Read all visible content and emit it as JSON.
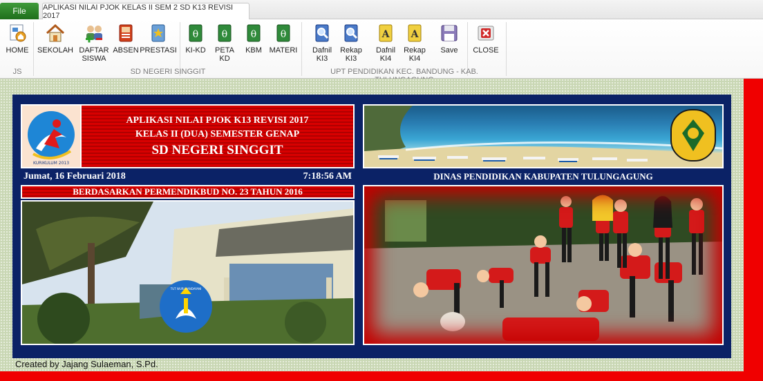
{
  "tabs": {
    "file": "File",
    "active": "APLIKASI NILAI PJOK KELAS II SEM 2 SD K13 REVISI 2017"
  },
  "ribbon": {
    "buttons": [
      {
        "label": "HOME",
        "icon": "home-page-icon"
      },
      {
        "label": "SEKOLAH",
        "icon": "house-icon"
      },
      {
        "label": "DAFTAR SISWA",
        "icon": "users-icon"
      },
      {
        "label": "ABSEN",
        "icon": "book-icon"
      },
      {
        "label": "PRESTASI",
        "icon": "trophy-book-icon"
      },
      {
        "label": "KI-KD",
        "icon": "theta-book-icon"
      },
      {
        "label": "PETA KD",
        "icon": "theta-book-icon"
      },
      {
        "label": "KBM",
        "icon": "theta-book-icon"
      },
      {
        "label": "MATERI",
        "icon": "theta-book-icon"
      },
      {
        "label": "Dafnil KI3",
        "icon": "magnifier-book-icon"
      },
      {
        "label": "Rekap KI3",
        "icon": "magnifier-book-icon"
      },
      {
        "label": "Dafnil KI4",
        "icon": "letter-a-book-icon"
      },
      {
        "label": "Rekap KI4",
        "icon": "letter-a-book-icon"
      },
      {
        "label": "Save",
        "icon": "floppy-disk-icon"
      },
      {
        "label": "CLOSE",
        "icon": "close-icon"
      }
    ],
    "groups": [
      "JS",
      "SD NEGERI SINGGIT",
      "UPT PENDIDIKAN KEC. BANDUNG - KAB. TULUNGAGUNG"
    ]
  },
  "header": {
    "line1": "APLIKASI NILAI PJOK K13 REVISI 2017",
    "line2": "KELAS II (DUA) SEMESTER GENAP",
    "school": "SD NEGERI SINGGIT",
    "date": "Jumat, 16 Februari 2018",
    "time": "7:18:56 AM",
    "regulation": "BERDASARKAN PERMENDIKBUD NO. 23 TAHUN 2016",
    "agency": "DINAS PENDIDIKAN KABUPATEN TULUNGAGUNG",
    "logo_text": "KURIKULUM 2013",
    "emblem_text": "TUT WURI HANDAYANI"
  },
  "footer": {
    "credit": "Created by Jajang Sulaeman, S.Pd."
  },
  "colors": {
    "accent_red": "#d80000",
    "navy": "#0b2266",
    "file_green": "#2e8b2a"
  }
}
